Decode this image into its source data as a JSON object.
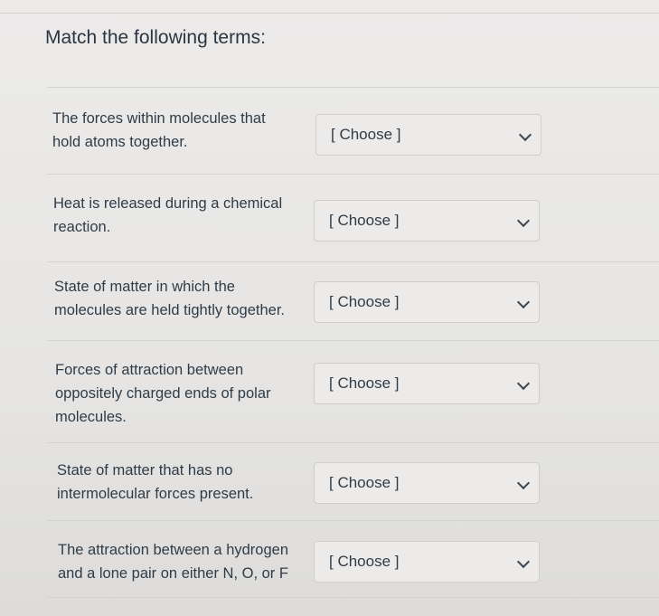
{
  "title": "Match the following terms:",
  "rows": [
    {
      "term": "The forces within molecules that\nhold atoms together.",
      "select": "[ Choose ]"
    },
    {
      "term": "Heat is released during a chemical\nreaction.",
      "select": "[ Choose ]"
    },
    {
      "term": "State of matter in which the\nmolecules are held tightly together.",
      "select": "[ Choose ]"
    },
    {
      "term": "Forces of attraction between\noppositely charged ends of polar\nmolecules.",
      "select": "[ Choose ]"
    },
    {
      "term": "State of matter that has no\nintermolecular forces present.",
      "select": "[ Choose ]"
    },
    {
      "term": "The attraction between a hydrogen\nand a lone pair on either N, O, or F",
      "select": "[ Choose ]"
    }
  ]
}
